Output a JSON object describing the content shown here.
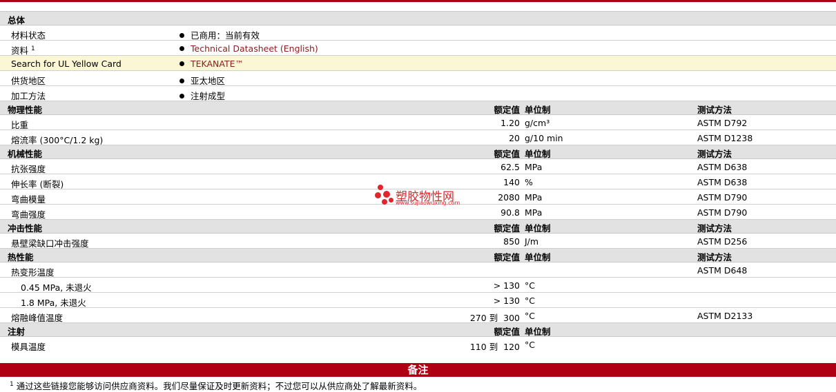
{
  "sections": {
    "general": {
      "title": "总体"
    },
    "physical": {
      "title": "物理性能",
      "col_value": "额定值",
      "col_unit": "单位制",
      "col_test": "测试方法"
    },
    "mechanical": {
      "title": "机械性能",
      "col_value": "额定值",
      "col_unit": "单位制",
      "col_test": "测试方法"
    },
    "impact": {
      "title": "冲击性能",
      "col_value": "额定值",
      "col_unit": "单位制",
      "col_test": "测试方法"
    },
    "thermal": {
      "title": "热性能",
      "col_value": "额定值",
      "col_unit": "单位制",
      "col_test": "测试方法"
    },
    "injection": {
      "title": "注射",
      "col_value": "额定值",
      "col_unit": "单位制"
    }
  },
  "general_rows": [
    {
      "label": "材料状态",
      "value": "已商用：当前有效"
    },
    {
      "label": "资料",
      "sup": "1",
      "value": "Technical Datasheet (English)"
    },
    {
      "label": "Search for UL Yellow Card",
      "value": "TEKANATE™"
    },
    {
      "label": "供货地区",
      "value": "亚太地区"
    },
    {
      "label": "加工方法",
      "value": "注射成型"
    }
  ],
  "physical_rows": [
    {
      "label": "比重",
      "value": "1.20",
      "unit": "g/cm³",
      "test": "ASTM D792"
    },
    {
      "label": "熔流率 (300°C/1.2 kg)",
      "value": "20",
      "unit": "g/10 min",
      "test": "ASTM D1238"
    }
  ],
  "mechanical_rows": [
    {
      "label": "抗张强度",
      "value": "62.5",
      "unit": "MPa",
      "test": "ASTM D638"
    },
    {
      "label": "伸长率 (断裂)",
      "value": "140",
      "unit": "%",
      "test": "ASTM D638"
    },
    {
      "label": "弯曲模量",
      "value": "2080",
      "unit": "MPa",
      "test": "ASTM D790"
    },
    {
      "label": "弯曲强度",
      "value": "90.8",
      "unit": "MPa",
      "test": "ASTM D790"
    }
  ],
  "impact_rows": [
    {
      "label": "悬壁梁缺口冲击强度",
      "value": "850",
      "unit": "J/m",
      "test": "ASTM D256"
    }
  ],
  "thermal_rows": [
    {
      "label": "热变形温度",
      "value": "",
      "unit": "",
      "test": "ASTM D648"
    },
    {
      "label": "0.45 MPa, 未退火",
      "value": "> 130",
      "unit": "°C",
      "test": ""
    },
    {
      "label": "1.8 MPa, 未退火",
      "value": "> 130",
      "unit": "°C",
      "test": ""
    },
    {
      "label": "熔融峰值温度",
      "value": "270 到  300",
      "unit": "°C",
      "test": "ASTM D2133"
    }
  ],
  "injection_rows": [
    {
      "label": "模具温度",
      "value": "110 到  120",
      "unit": "°C",
      "test": ""
    }
  ],
  "notes": {
    "title": "备注",
    "sup": "1",
    "text": "通过这些链接您能够访问供应商资料。我们尽量保证及时更新资料；不过您可以从供应商处了解最新资料。"
  },
  "watermark": {
    "name": "塑胶物性网",
    "url": "www.sujiaowuxing.com"
  },
  "colors": {
    "accent": "#b00014",
    "link": "#8b1a1a",
    "highlight": "#fbf7d4"
  }
}
